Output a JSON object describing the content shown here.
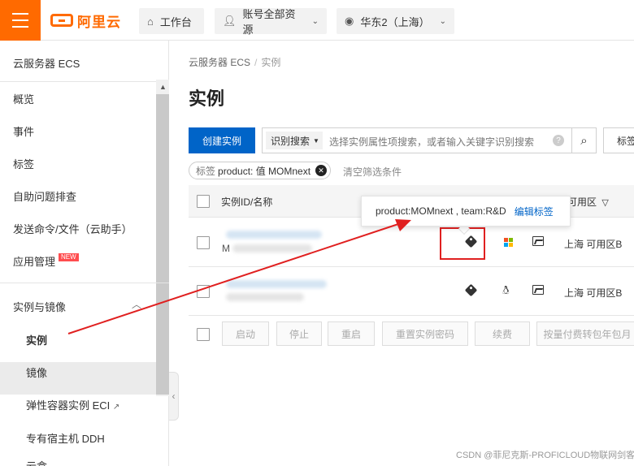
{
  "topbar": {
    "brand": "阿里云",
    "workbench": "工作台",
    "resources": "账号全部资源",
    "region": "华东2（上海）"
  },
  "sidebar": {
    "title": "云服务器 ECS",
    "items": [
      {
        "label": "概览"
      },
      {
        "label": "事件"
      },
      {
        "label": "标签"
      },
      {
        "label": "自助问题排查"
      },
      {
        "label": "发送命令/文件（云助手）"
      },
      {
        "label": "应用管理",
        "badge": "NEW"
      }
    ],
    "section": "实例与镜像",
    "sub_items": [
      {
        "label": "实例"
      },
      {
        "label": "镜像"
      },
      {
        "label": "弹性容器实例 ECI"
      },
      {
        "label": "专有宿主机 DDH"
      },
      {
        "label": "云盒"
      }
    ]
  },
  "main": {
    "breadcrumb": [
      "云服务器 ECS",
      "实例"
    ],
    "title": "实例",
    "create_button": "创建实例",
    "search_type": "识别搜索",
    "search_placeholder": "选择实例属性项搜索，或者输入关键字识别搜索",
    "tag_button": "标签",
    "filter": {
      "key": "标签",
      "value": "product: 值 MOMnext"
    },
    "clear_filter": "清空筛选条件",
    "table": {
      "columns": [
        "实例ID/名称",
        "可用区"
      ],
      "rows": [
        {
          "name_prefix": "M",
          "os": "windows",
          "zone": "上海 可用区B"
        },
        {
          "name_prefix": "",
          "os": "linux",
          "zone": "上海 可用区B"
        }
      ]
    },
    "batch_actions": [
      "启动",
      "停止",
      "重启",
      "重置实例密码",
      "续费",
      "按量付费转包年包月"
    ],
    "tooltip": {
      "text": "product:MOMnext , team:R&D",
      "edit": "编辑标签"
    }
  },
  "watermark": "CSDN @菲尼克斯-PROFICLOUD物联网剑客",
  "colors": {
    "brand": "#ff6a00",
    "primary": "#0064c8",
    "annotation": "#e02020"
  }
}
